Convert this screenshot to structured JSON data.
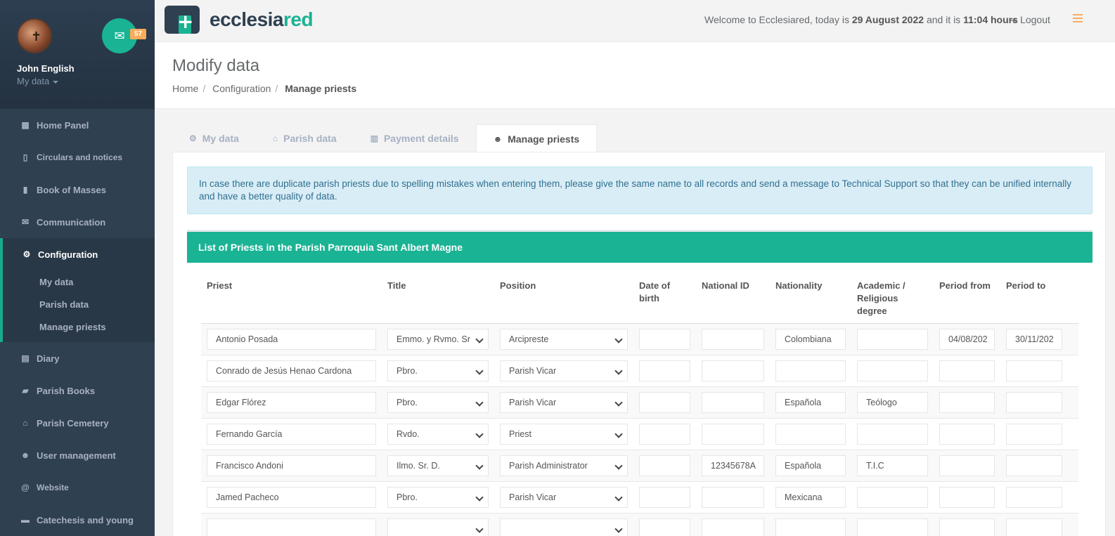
{
  "user": {
    "name": "John English",
    "menu_label": "My data",
    "mail_count": "57"
  },
  "sidebar": {
    "items": [
      {
        "label": "Home Panel",
        "icon": "th-large-icon"
      },
      {
        "label": "Circulars and notices",
        "icon": "file-icon"
      },
      {
        "label": "Book of Masses",
        "icon": "bookmark-icon"
      },
      {
        "label": "Communication",
        "icon": "envelope-icon"
      },
      {
        "label": "Configuration",
        "icon": "cogs-icon"
      },
      {
        "label": "Diary",
        "icon": "calendar-icon"
      },
      {
        "label": "Parish Books",
        "icon": "book-icon"
      },
      {
        "label": "Parish Cemetery",
        "icon": "bank-icon"
      },
      {
        "label": "User management",
        "icon": "users-icon"
      },
      {
        "label": "Website",
        "icon": "at-icon"
      },
      {
        "label": "Catechesis and young",
        "icon": "folder-icon"
      }
    ],
    "config_sub": [
      "My data",
      "Parish data",
      "Manage priests"
    ]
  },
  "header": {
    "logo_a": "ecclesia",
    "logo_b": "red",
    "welcome_pre": "Welcome to Ecclesiared, today is",
    "date": "29 August 2022",
    "welcome_mid": "and it is",
    "time": "11:04 hours",
    "logout": "Logout"
  },
  "page": {
    "title": "Modify data",
    "breadcrumb": [
      "Home",
      "Configuration",
      "Manage priests"
    ]
  },
  "tabs": [
    {
      "label": "My data",
      "icon": "cogs-icon"
    },
    {
      "label": "Parish data",
      "icon": "home-icon"
    },
    {
      "label": "Payment details",
      "icon": "bar-chart-icon"
    },
    {
      "label": "Manage priests",
      "icon": "users-icon"
    }
  ],
  "alert": "In case there are duplicate parish priests due to spelling mistakes when entering them, please give the same name to all records and send a message to Technical Support so that they can be unified internally and have a better quality of data.",
  "box_title": "List of Priests in the Parish Parroquia Sant Albert Magne",
  "table": {
    "headers": [
      "Priest",
      "Title",
      "Position",
      "Date of birth",
      "National ID",
      "Nationality",
      "Academic / Religious degree",
      "Period from",
      "Period to"
    ],
    "rows": [
      [
        "Antonio Posada",
        "Emmo. y Rvmo. Sr",
        "Arcipreste",
        "",
        "",
        "Colombiana",
        "",
        "04/08/202",
        "30/11/202"
      ],
      [
        "Conrado de Jesús Henao Cardona",
        "Pbro.",
        "Parish Vicar",
        "",
        "",
        "",
        "",
        "",
        ""
      ],
      [
        "Edgar Flórez",
        "Pbro.",
        "Parish Vicar",
        "",
        "",
        "Española",
        "Teólogo",
        "",
        ""
      ],
      [
        "Fernando García",
        "Rvdo.",
        "Priest",
        "",
        "",
        "",
        "",
        "",
        ""
      ],
      [
        "Francisco Andoni",
        "Ilmo. Sr. D.",
        "Parish Administrator",
        "",
        "12345678A",
        "Española",
        "T.I.C",
        "",
        ""
      ],
      [
        "Jamed Pacheco",
        "Pbro.",
        "Parish Vicar",
        "",
        "",
        "Mexicana",
        "",
        "",
        ""
      ],
      [
        "",
        "",
        "",
        "",
        "",
        "",
        "",
        "",
        ""
      ]
    ]
  }
}
